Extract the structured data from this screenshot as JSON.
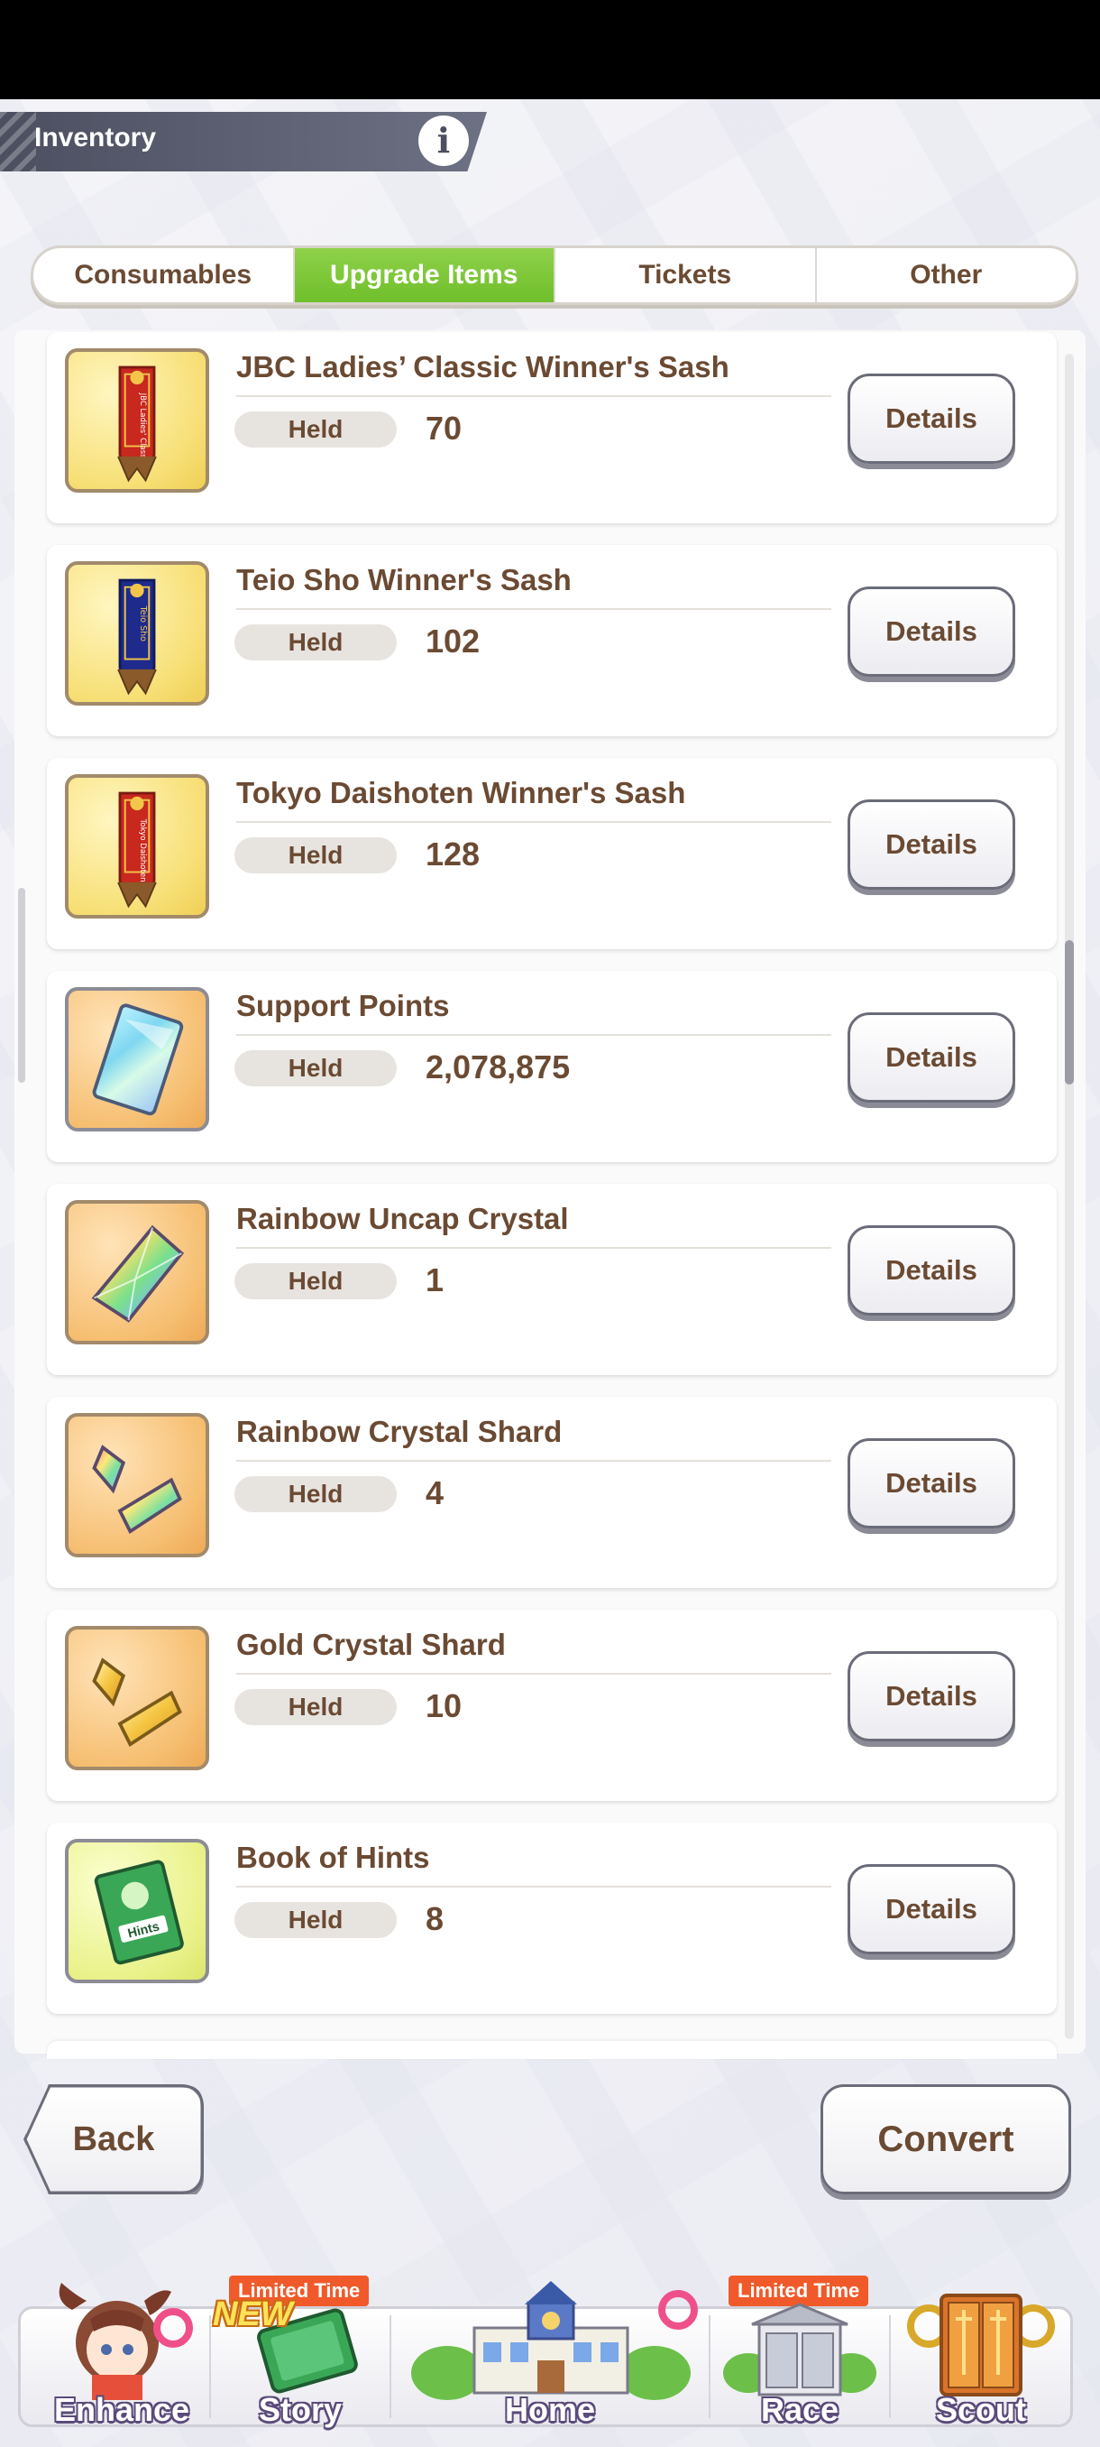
{
  "header": {
    "title": "Inventory",
    "info_icon": "i"
  },
  "tabs": [
    {
      "label": "Consumables",
      "active": false
    },
    {
      "label": "Upgrade Items",
      "active": true
    },
    {
      "label": "Tickets",
      "active": false
    },
    {
      "label": "Other",
      "active": false
    }
  ],
  "held_label": "Held",
  "details_label": "Details",
  "items": [
    {
      "name": "JBC Ladies’ Classic Winner's Sash",
      "held": "70",
      "icon": "red-sash-icon"
    },
    {
      "name": "Teio Sho Winner's Sash",
      "held": "102",
      "icon": "blue-sash-icon"
    },
    {
      "name": "Tokyo Daishoten Winner's Sash",
      "held": "128",
      "icon": "red-sash-icon"
    },
    {
      "name": "Support Points",
      "held": "2,078,875",
      "icon": "support-points-card-icon"
    },
    {
      "name": "Rainbow Uncap Crystal",
      "held": "1",
      "icon": "rainbow-crystal-icon"
    },
    {
      "name": "Rainbow Crystal Shard",
      "held": "4",
      "icon": "rainbow-shard-icon"
    },
    {
      "name": "Gold Crystal Shard",
      "held": "10",
      "icon": "gold-shard-icon"
    },
    {
      "name": "Book of Hints",
      "held": "8",
      "icon": "hint-book-icon"
    }
  ],
  "sash_texts": {
    "jbc": "JBC Ladies' Classic",
    "teio": "Teio Sho",
    "tokyo": "Tokyo Daishoten"
  },
  "hint_book_text": "Hints",
  "buttons": {
    "back": "Back",
    "convert": "Convert"
  },
  "nav": {
    "enhance": "Enhance",
    "story": "Story",
    "home": "Home",
    "race": "Race",
    "scout": "Scout",
    "limited_time": "Limited Time",
    "new": "NEW"
  },
  "colors": {
    "active_tab": "#7cc83a",
    "text_brown": "#6b4a33",
    "limited_badge": "#f05a2a"
  }
}
